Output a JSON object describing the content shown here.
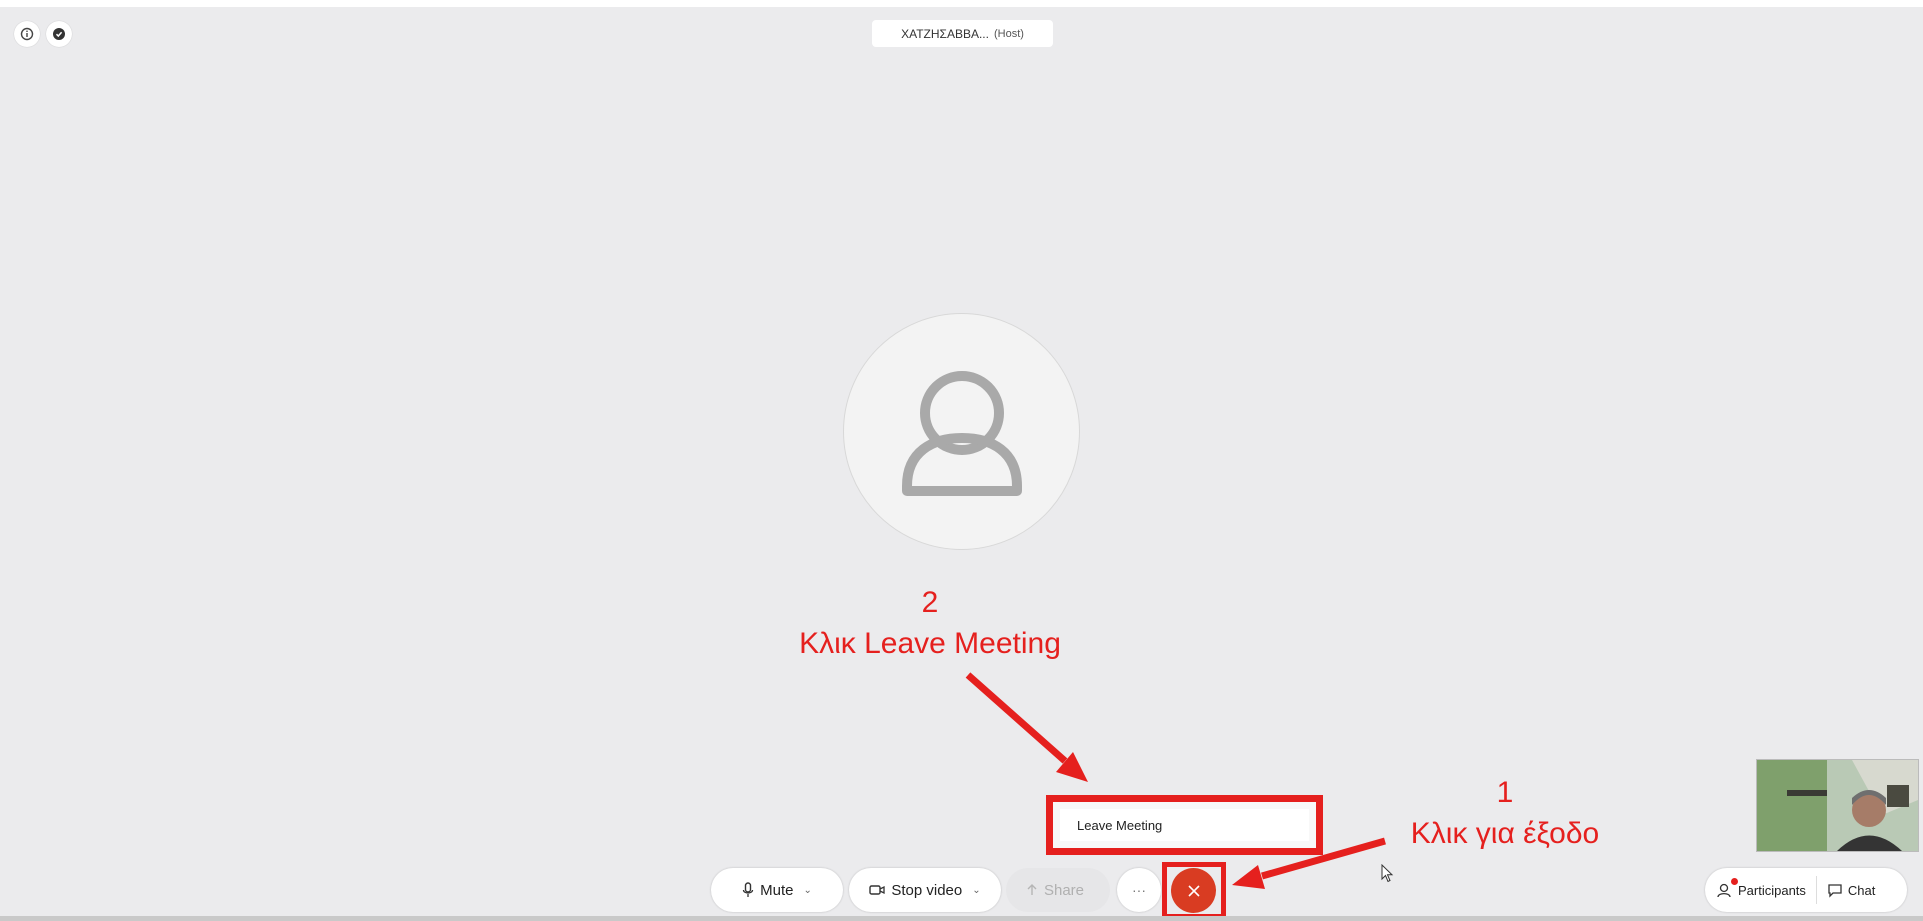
{
  "header": {
    "host_name": "ΧΑΤΖΗΣΑΒΒΑ...",
    "host_role": "(Host)"
  },
  "annotations": {
    "step2_number": "2",
    "step2_text": "Κλικ Leave Meeting",
    "step1_number": "1",
    "step1_text": "Κλικ για έξοδο",
    "color": "#e5201e"
  },
  "leave_menu": {
    "item_label": "Leave Meeting"
  },
  "toolbar": {
    "mute_label": "Mute",
    "video_label": "Stop video",
    "share_label": "Share",
    "more_label": "···",
    "end_icon": "close-icon",
    "end_color": "#d93c22"
  },
  "right_toolbar": {
    "participants_label": "Participants",
    "chat_label": "Chat"
  }
}
